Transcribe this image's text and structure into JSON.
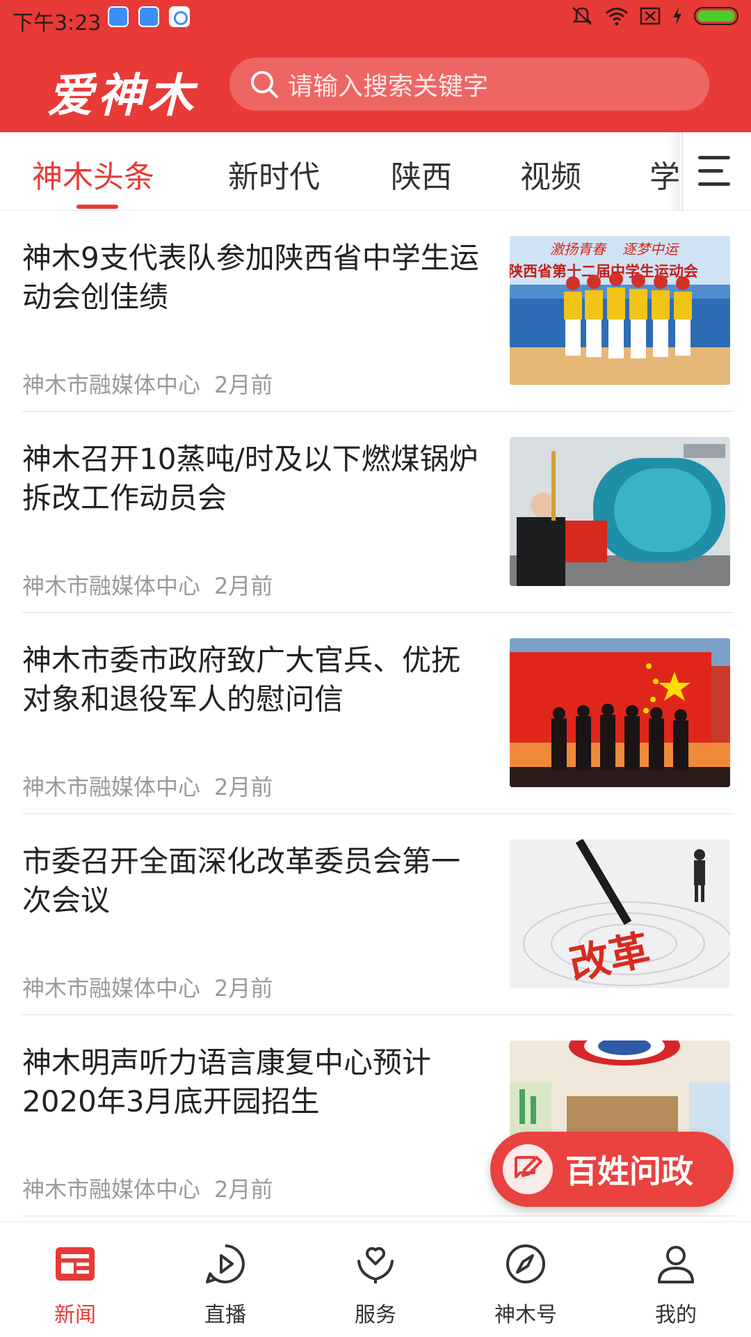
{
  "status_bar": {
    "time": "下午3:23"
  },
  "header": {
    "logo": "爱神木",
    "search_placeholder": "请输入搜索关键字"
  },
  "tabs": [
    {
      "label": "神木头条",
      "active": true
    },
    {
      "label": "新时代",
      "active": false
    },
    {
      "label": "陕西",
      "active": false
    },
    {
      "label": "视频",
      "active": false
    },
    {
      "label": "学",
      "active": false
    }
  ],
  "news": [
    {
      "title": "神木9支代表队参加陕西省中学生运动会创佳绩",
      "source": "神木市融媒体中心",
      "time": "2月前",
      "image": "students-sports-medal-photo",
      "image_banner": "陕西省第十二届中学生运动会",
      "image_slogan_left": "激扬青春",
      "image_slogan_right": "逐梦中运"
    },
    {
      "title": "神木召开10蒸吨/时及以下燃煤锅炉拆改工作动员会",
      "source": "神木市融媒体中心",
      "time": "2月前",
      "image": "industrial-boiler-photo"
    },
    {
      "title": "神木市委市政府致广大官兵、优抚对象和退役军人的慰问信",
      "source": "神木市融媒体中心",
      "time": "2月前",
      "image": "flag-soldiers-salute-photo"
    },
    {
      "title": "市委召开全面深化改革委员会第一次会议",
      "source": "神木市融媒体中心",
      "time": "2月前",
      "image": "reform-concept-photo",
      "image_text": "改革"
    },
    {
      "title": "神木明声听力语言康复中心预计2020年3月底开园招生",
      "source": "神木市融媒体中心",
      "time": "2月前",
      "image": "classroom-interior-photo"
    }
  ],
  "fab": {
    "label": "百姓问政",
    "icon": "edit-bubble-icon"
  },
  "bottom_nav": [
    {
      "label": "新闻",
      "icon": "news-icon",
      "active": true
    },
    {
      "label": "直播",
      "icon": "play-icon",
      "active": false
    },
    {
      "label": "服务",
      "icon": "heart-hand-icon",
      "active": false
    },
    {
      "label": "神木号",
      "icon": "compass-icon",
      "active": false
    },
    {
      "label": "我的",
      "icon": "user-icon",
      "active": false
    }
  ],
  "colors": {
    "brand_red": "#e83a37",
    "search_bg": "#ee6663",
    "meta_gray": "#9a9a9a"
  }
}
